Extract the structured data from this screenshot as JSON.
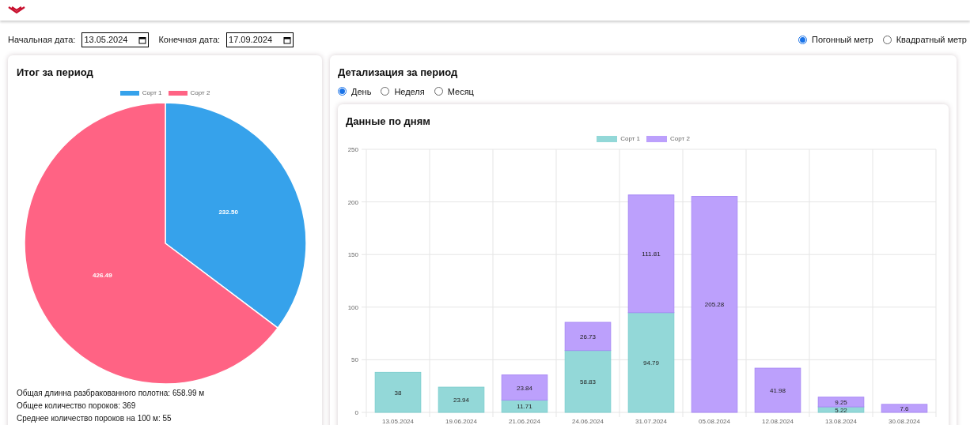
{
  "filters": {
    "start_label": "Начальная дата:",
    "start_value": "13.05.2024",
    "end_label": "Конечная дата:",
    "end_value": "17.09.2024"
  },
  "units": [
    {
      "label": "Погонный метр",
      "selected": true
    },
    {
      "label": "Квадратный метр",
      "selected": false
    }
  ],
  "summary": {
    "title": "Итог за период",
    "chart_data": {
      "type": "pie",
      "categories": [
        "Сорт 1",
        "Сорт 2"
      ],
      "values": [
        232.5,
        426.49
      ],
      "colors": [
        "#36a2eb",
        "#ff6384"
      ],
      "legend": "top",
      "value_labels": [
        "232.50",
        "426.49"
      ]
    },
    "stats": [
      "Общая длинна разбракованного полотна: 658.99 м",
      "Общее количество пороков: 369",
      "Среднее количество пороков на 100 м: 55"
    ]
  },
  "details": {
    "title": "Детализация за период",
    "periods": [
      {
        "label": "День",
        "selected": true
      },
      {
        "label": "Неделя",
        "selected": false
      },
      {
        "label": "Месяц",
        "selected": false
      }
    ],
    "chart_title": "Данные по дням",
    "chart_data": {
      "type": "bar",
      "stacked": true,
      "data_labels": true,
      "categories": [
        "13.05.2024",
        "19.06.2024",
        "21.06.2024",
        "24.06.2024",
        "31.07.2024",
        "05.08.2024",
        "12.08.2024",
        "13.08.2024",
        "30.08.2024"
      ],
      "series": [
        {
          "name": "Сорт 1",
          "color": "#93d8d8",
          "values": [
            38,
            23.94,
            11.71,
            58.83,
            94.79,
            null,
            null,
            5.22,
            null
          ]
        },
        {
          "name": "Сорт 2",
          "color": "#bca0fc",
          "values": [
            null,
            null,
            23.84,
            26.73,
            111.81,
            205.28,
            41.98,
            9.25,
            7.6
          ]
        }
      ],
      "legend": "top",
      "grid": true,
      "ylim": [
        0,
        250
      ],
      "yticks": [
        0,
        50,
        100,
        150,
        200,
        250
      ]
    }
  }
}
